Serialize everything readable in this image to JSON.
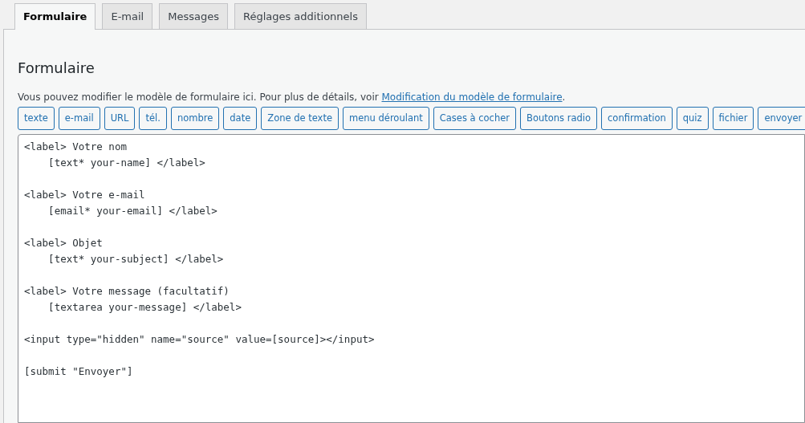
{
  "tabs": [
    {
      "label": "Formulaire",
      "selected": true
    },
    {
      "label": "E-mail",
      "selected": false
    },
    {
      "label": "Messages",
      "selected": false
    },
    {
      "label": "Réglages additionnels",
      "selected": false
    }
  ],
  "panel": {
    "title": "Formulaire",
    "description": "Vous pouvez modifier le modèle de formulaire ici. Pour plus de détails, voir",
    "link": "Modification du modèle de formulaire",
    "link_suffix": "."
  },
  "tag_buttons": [
    "texte",
    "e-mail",
    "URL",
    "tél.",
    "nombre",
    "date",
    "Zone de texte",
    "menu déroulant",
    "Cases à cocher",
    "Boutons radio",
    "confirmation",
    "quiz",
    "fichier",
    "envoyer"
  ],
  "editor": {
    "blocks": [
      [
        "<label> Votre nom",
        "    [text* your-name] </label>"
      ],
      [
        "<label> Votre e-mail",
        "    [email* your-email] </label>"
      ],
      [
        "<label> Objet",
        "    [text* your-subject] </label>"
      ],
      [
        "<label> Votre message (facultatif)",
        "    [textarea your-message] </label>"
      ],
      [
        "<input type=\"hidden\" name=\"source\" value=[source]></input>"
      ],
      [
        "[submit \"Envoyer\"]"
      ]
    ]
  }
}
